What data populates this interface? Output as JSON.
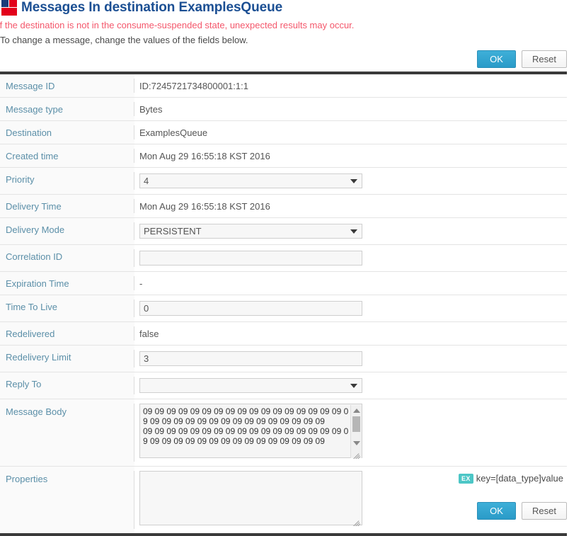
{
  "header": {
    "logo_icon": "brand-square-icon",
    "title": "Messages In destination ExamplesQueue"
  },
  "intro": {
    "warning": "If the destination is not in the consume-suspended state, unexpected results may occur.",
    "note": "To change a message, change the values of the fields below."
  },
  "buttons": {
    "ok_label": "OK",
    "reset_label": "Reset"
  },
  "colors": {
    "title": "#1b4f93",
    "warning": "#f4576b",
    "label": "#5b8fa8",
    "primary_button": "#2a9bc8",
    "badge": "#4cc6c6",
    "table_rule": "#3a3a3a"
  },
  "fields": [
    {
      "label": "Message ID",
      "type": "static",
      "value": "ID:7245721734800001:1:1"
    },
    {
      "label": "Message type",
      "type": "static",
      "value": "Bytes"
    },
    {
      "label": "Destination",
      "type": "static",
      "value": "ExamplesQueue"
    },
    {
      "label": "Created time",
      "type": "static",
      "value": "Mon Aug 29 16:55:18 KST 2016"
    },
    {
      "label": "Priority",
      "type": "select",
      "value": "4"
    },
    {
      "label": "Delivery Time",
      "type": "static",
      "value": "Mon Aug 29 16:55:18 KST 2016"
    },
    {
      "label": "Delivery Mode",
      "type": "select",
      "value": "PERSISTENT"
    },
    {
      "label": "Correlation ID",
      "type": "input",
      "value": ""
    },
    {
      "label": "Expiration Time",
      "type": "static",
      "value": "-"
    },
    {
      "label": "Time To Live",
      "type": "input",
      "value": "0"
    },
    {
      "label": "Redelivered",
      "type": "static",
      "value": "false"
    },
    {
      "label": "Redelivery Limit",
      "type": "input",
      "value": "3"
    },
    {
      "label": "Reply To",
      "type": "select",
      "value": ""
    },
    {
      "label": "Message Body",
      "type": "textarea",
      "value": "09 09 09 09 09 09 09 09 09 09 09 09 09 09 09 09 09 09 09 09 09 09 09 09 09 09 09 09 09 09 09 09 09\n09 09 09 09 09 09 09 09 09 09 09 09 09 09 09 09 09 09 09 09 09 09 09 09 09 09 09 09 09 09 09 09 09"
    },
    {
      "label": "Properties",
      "type": "textarea",
      "value": "",
      "hint_badge": "EX",
      "hint_text": "key=[data_type]value"
    }
  ]
}
